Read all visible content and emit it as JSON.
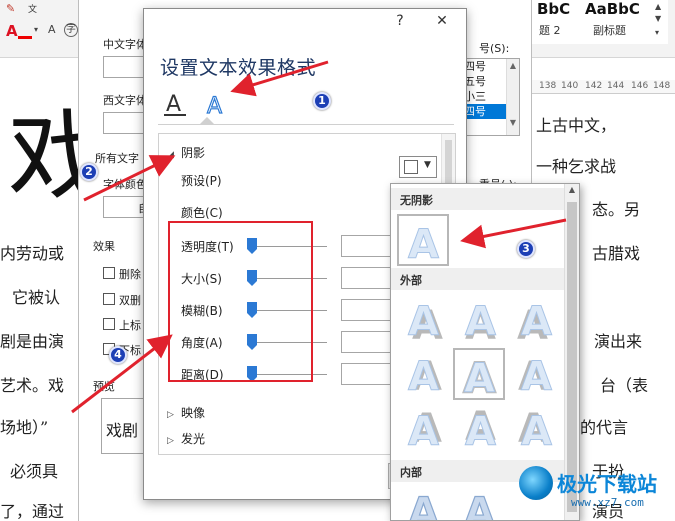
{
  "document": {
    "big_char": "戏",
    "style_samples": [
      {
        "sample": "BbC",
        "name": "题 2"
      },
      {
        "sample": "AaBbC",
        "name": "副标题"
      }
    ],
    "ruler_marks": [
      "138",
      "140",
      "142",
      "144",
      "146",
      "148"
    ],
    "lines": [
      {
        "left": "上古中文，",
        "right": ""
      },
      {
        "left": "一种乞求战",
        "right": ""
      },
      {
        "left": "态。另",
        "right": ""
      },
      {
        "left": "内劳动或",
        "right": "古腊戏"
      },
      {
        "left": "它被认",
        "right": ""
      },
      {
        "left": "剧是由演",
        "right": "演出来"
      },
      {
        "left": "艺术。戏",
        "right": "台（表"
      },
      {
        "left": "场地）”",
        "right": "的代言"
      },
      {
        "left": "必须具",
        "right": "于扮"
      },
      {
        "left": "了，通过",
        "right": "演员"
      }
    ]
  },
  "font_dialog": {
    "chinese_font_label": "中文字体",
    "western_font_label": "西文字体",
    "all_text_label": "所有文字",
    "font_color_label": "字体颜色",
    "font_color_value": "自",
    "size_label": "号(S):",
    "size_items": [
      "四号",
      "五号",
      "小三",
      "四号"
    ],
    "size_selected_index": 3,
    "emphasis_label": "重号(·):",
    "effects_label": "效果",
    "effects": [
      "删除",
      "双删",
      "上标",
      "下标"
    ],
    "preview_label": "预览",
    "preview_text": "戏剧"
  },
  "effects_dialog": {
    "help_button": "?",
    "close_button": "✕",
    "title": "设置文本效果格式",
    "sections": {
      "shadow": "阴影",
      "reflection": "映像",
      "glow": "发光"
    },
    "rows": {
      "preset": "预设(P)",
      "color": "颜色(C)",
      "transparency": "透明度(T)",
      "size": "大小(S)",
      "blur": "模糊(B)",
      "angle": "角度(A)",
      "distance": "距离(D)"
    }
  },
  "shadow_gallery": {
    "headers": {
      "none": "无阴影",
      "outer": "外部",
      "inner": "内部"
    },
    "tile_letter": "A"
  },
  "annotations": {
    "badges": [
      "1",
      "2",
      "3",
      "4"
    ]
  },
  "watermark": {
    "name": "极光下载站",
    "url": "www.xz7.com"
  },
  "colors": {
    "accent_blue": "#1f3864",
    "arrow_red": "#e0222d",
    "slider_blue": "#2b79d4",
    "badge_blue": "#1d3fb5"
  }
}
